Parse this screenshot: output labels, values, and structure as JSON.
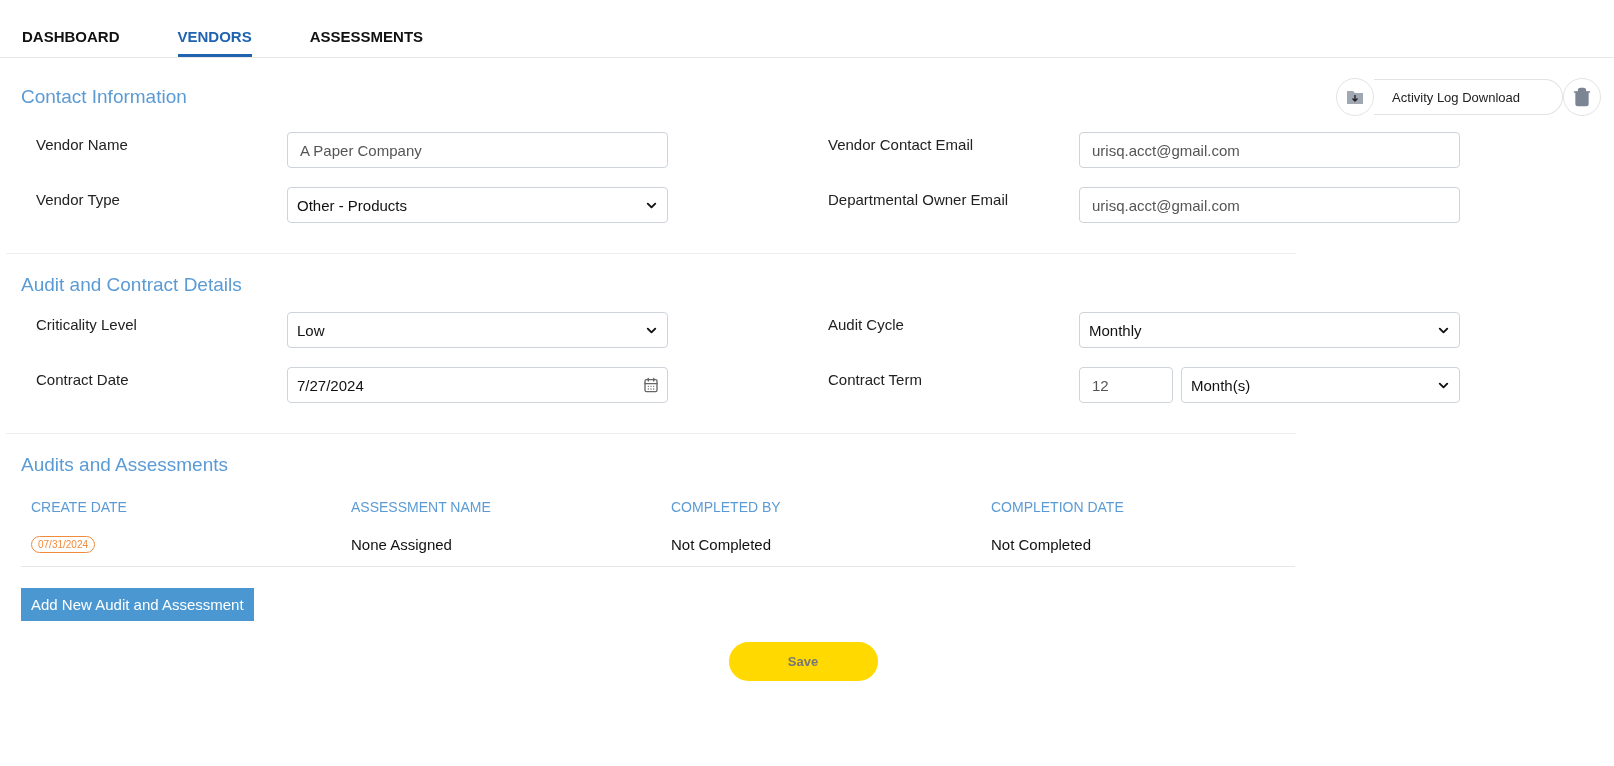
{
  "tabs": [
    {
      "label": "DASHBOARD",
      "selected": false
    },
    {
      "label": "VENDORS",
      "selected": true
    },
    {
      "label": "ASSESSMENTS",
      "selected": false
    }
  ],
  "actions": {
    "download": "Activity Log Download"
  },
  "sections": [
    {
      "title": "Contact Information",
      "fields": [
        {
          "label": "Vendor Name",
          "kind": "text",
          "value": "A Paper Company"
        },
        {
          "label": "Vendor Contact Email",
          "kind": "text",
          "value": "urisq.acct@gmail.com"
        },
        {
          "label": "Vendor Type",
          "kind": "select",
          "value": "Other - Products"
        },
        {
          "label": "Departmental Owner Email",
          "kind": "text",
          "value": "urisq.acct@gmail.com"
        }
      ]
    },
    {
      "title": "Audit and Contract Details",
      "fields": [
        {
          "label": "Criticality Level",
          "kind": "select",
          "value": "Low"
        },
        {
          "label": "Audit Cycle",
          "kind": "select",
          "value": "Monthly"
        },
        {
          "label": "Contract Date",
          "kind": "date",
          "value": "7/27/2024"
        },
        {
          "label": "Contract Term",
          "kind": "term",
          "value": "12",
          "unit": "Month(s)"
        }
      ]
    }
  ],
  "audits": {
    "title": "Audits and Assessments",
    "columns": [
      "CREATE DATE",
      "ASSESSMENT NAME",
      "COMPLETED BY",
      "COMPLETION DATE"
    ],
    "rows": [
      {
        "create_date": "07/31/2024",
        "assessment_name": "None Assigned",
        "completed_by": "Not Completed",
        "completion_date": "Not Completed"
      }
    ],
    "add_button": "Add New Audit and Assessment"
  },
  "save_button": "Save"
}
